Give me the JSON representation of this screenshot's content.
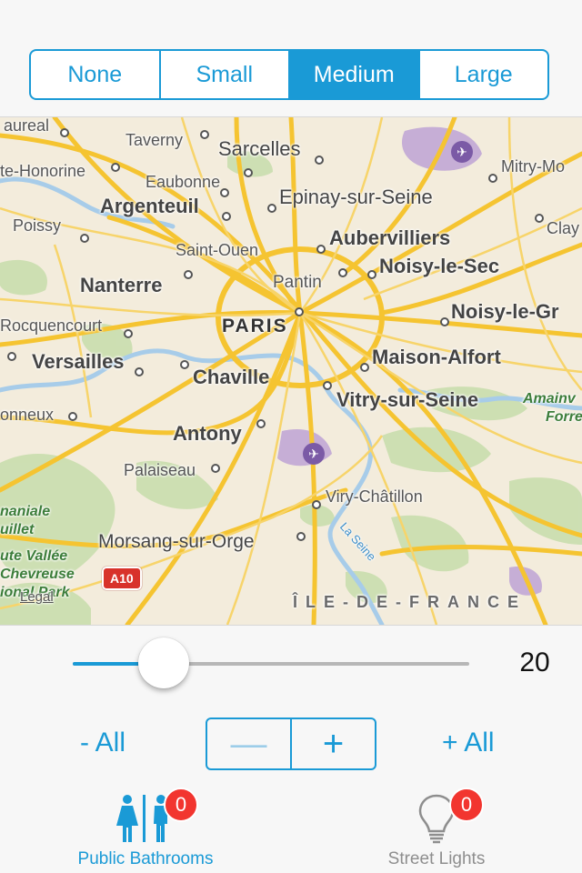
{
  "segmented": {
    "options": [
      "None",
      "Small",
      "Medium",
      "Large"
    ],
    "selected": "Medium"
  },
  "map": {
    "labels": {
      "aureal": "aureal",
      "taverny": "Taverny",
      "sarcelles": "Sarcelles",
      "mitry": "Mitry-Mo",
      "conflans": "te-Honorine",
      "eaubonne": "Eaubonne",
      "epinay": "Epinay-sur-Seine",
      "poissy": "Poissy",
      "argenteuil": "Argenteuil",
      "clay": "Clay",
      "saintouen": "Saint-Ouen",
      "aubervilliers": "Aubervilliers",
      "nanterre": "Nanterre",
      "pantin": "Pantin",
      "noisylesec": "Noisy-le-Sec",
      "rocquencourt": "Rocquencourt",
      "paris": "PARIS",
      "noisylegrand": "Noisy-le-Gr",
      "versailles": "Versailles",
      "maisonalfort": "Maison-Alfort",
      "chaville": "Chaville",
      "vitry": "Vitry-sur-Seine",
      "amainvilliers": "Amainv",
      "forret": "Forre",
      "onneux": "onneux",
      "antony": "Antony",
      "palaiseau": "Palaiseau",
      "viry": "Viry-Châtillon",
      "naniale": "naniale",
      "uillet": "uillet",
      "laseine": "La Seine",
      "morsang": "Morsang-sur-Orge",
      "hautevallee": "ute Vallée",
      "chevreuse": "Chevreuse",
      "ionalpark": "ional Park",
      "a10": "A10",
      "legal": "Legal",
      "iledefrance": "ÎLE-DE-FRANCE"
    }
  },
  "slider": {
    "value": 20,
    "fraction": 0.23
  },
  "stepper": {
    "minus_all": "- All",
    "plus_all": "+ All",
    "minus": "—",
    "plus": "+"
  },
  "tabbar": {
    "tabs": [
      {
        "label": "Public Bathrooms",
        "badge": "0",
        "icon": "restroom-icon",
        "active": true
      },
      {
        "label": "Street Lights",
        "badge": "0",
        "icon": "lightbulb-icon",
        "active": false
      }
    ]
  },
  "colors": {
    "accent": "#1a9ad6",
    "badge": "#f2352f",
    "map_background": "#f3ecdc",
    "road": "#f5c431",
    "park": "#c9deae",
    "water": "#a7cce9",
    "airport": "#c6aed6"
  }
}
